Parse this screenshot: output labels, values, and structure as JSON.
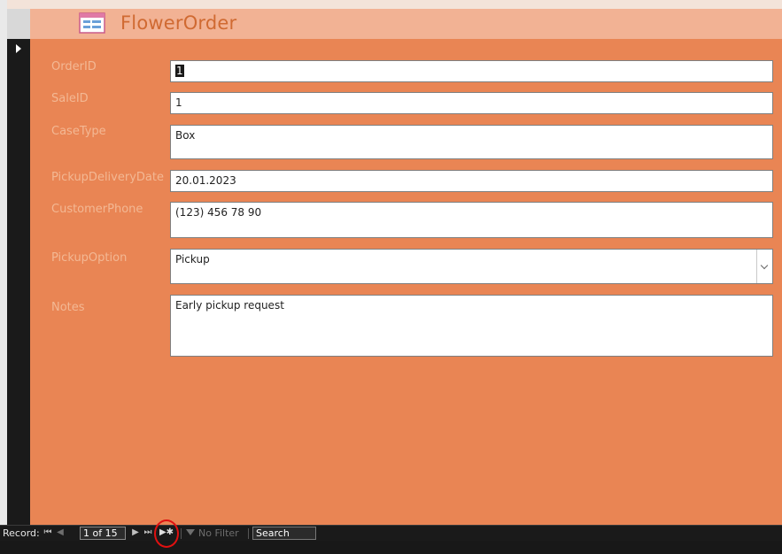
{
  "form": {
    "title": "FlowerOrder",
    "icon": "form-icon"
  },
  "fields": {
    "order_id": {
      "label": "OrderID",
      "value": "1"
    },
    "sale_id": {
      "label": "SaleID",
      "value": "1"
    },
    "case_type": {
      "label": "CaseType",
      "value": "Box"
    },
    "pickup_delivery_date": {
      "label": "PickupDeliveryDate",
      "value": "20.01.2023"
    },
    "customer_phone": {
      "label": "CustomerPhone",
      "value": "(123) 456 78 90"
    },
    "pickup_option": {
      "label": "PickupOption",
      "value": "Pickup"
    },
    "notes": {
      "label": "Notes",
      "value": "Early pickup request"
    }
  },
  "navigation": {
    "record_label": "Record:",
    "current_record": "1 of 15",
    "filter_label": "No Filter",
    "search_placeholder": "Search",
    "buttons": {
      "first": "⏮",
      "previous": "◀",
      "next": "▶",
      "last": "⏭",
      "new": "▶✱"
    }
  },
  "colors": {
    "header_bg": "#f2b294",
    "detail_bg": "#e98554",
    "label_text": "#f3b894",
    "title_text": "#d06a32",
    "highlight_ring": "#e01010"
  }
}
